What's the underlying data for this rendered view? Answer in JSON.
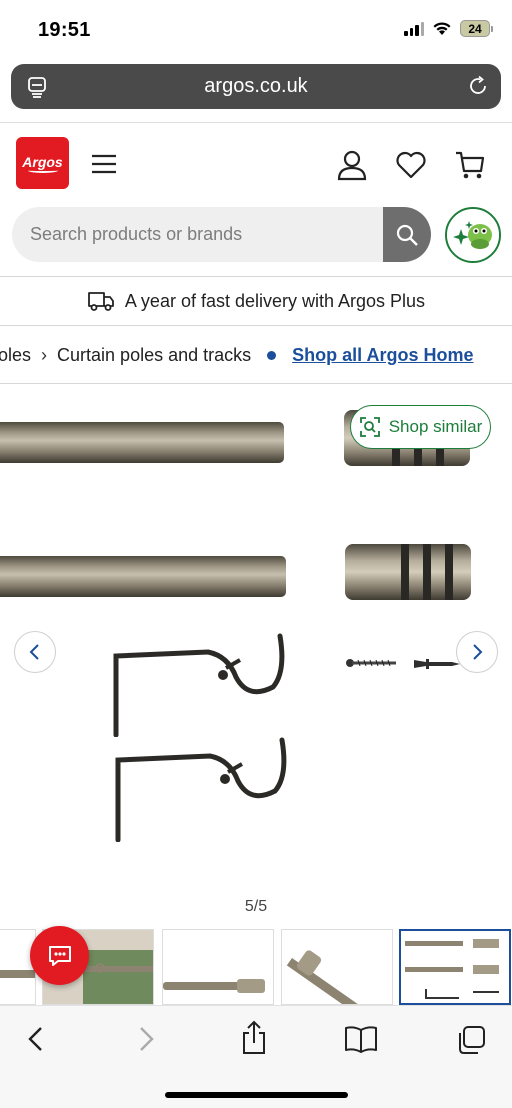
{
  "status_bar": {
    "time": "19:51",
    "battery": "24"
  },
  "browser": {
    "url": "argos.co.uk"
  },
  "header": {
    "logo_text": "Argos"
  },
  "search": {
    "placeholder": "Search products or brands"
  },
  "promo": {
    "text": "A year of fast delivery with Argos Plus"
  },
  "breadcrumb": {
    "items": [
      "oles",
      "Curtain poles and tracks"
    ],
    "shop_all": "Shop all Argos Home"
  },
  "gallery": {
    "shop_similar": "Shop similar",
    "counter": "5/5"
  },
  "colors": {
    "brand_red": "#e21b23",
    "link_blue": "#1b4f9b",
    "accent_green": "#1d7d3a"
  },
  "icons": [
    "tabs-icon",
    "reload-icon",
    "menu-icon",
    "account-icon",
    "heart-icon",
    "trolley-icon",
    "search-icon",
    "ai-assistant-icon",
    "van-icon",
    "visual-search-icon",
    "chevron-left-icon",
    "chevron-right-icon",
    "chat-icon",
    "back-icon",
    "forward-icon",
    "share-icon",
    "bookmarks-icon",
    "tabs-overview-icon"
  ]
}
